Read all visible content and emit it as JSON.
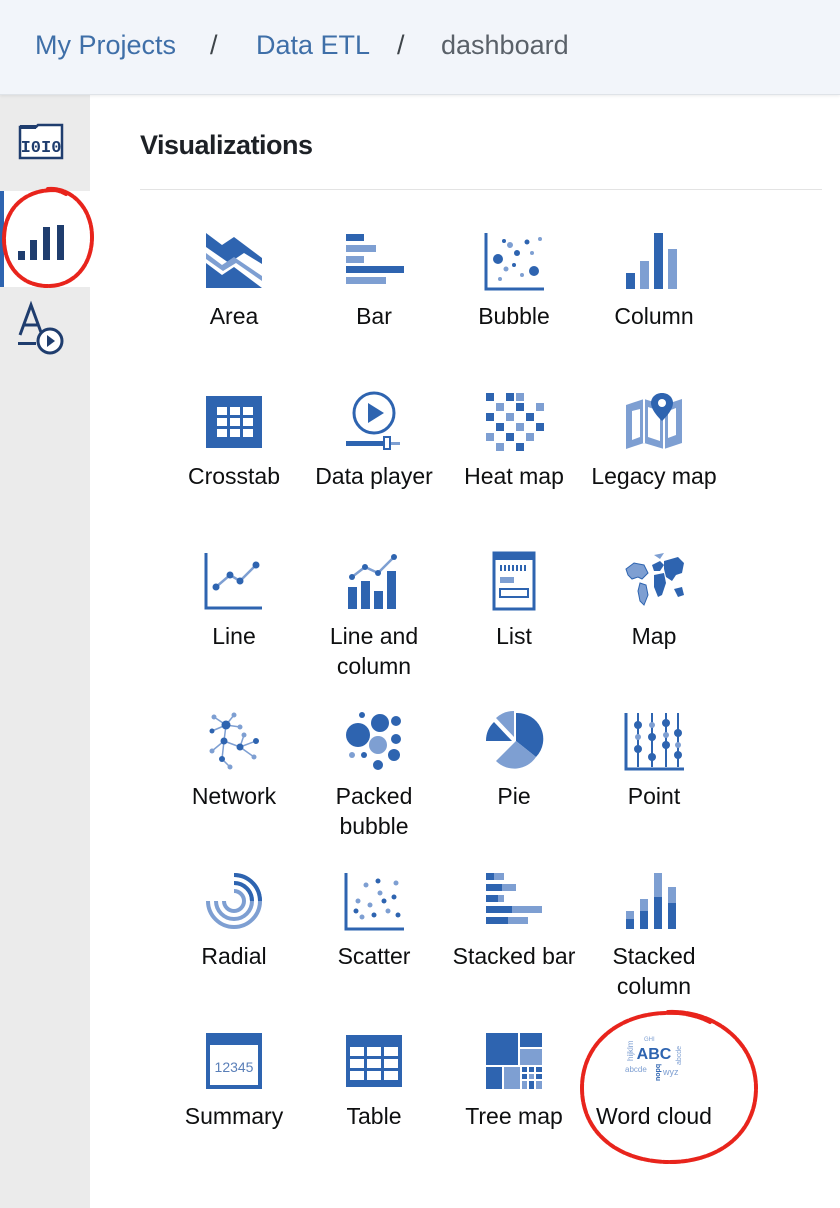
{
  "breadcrumb": {
    "items": [
      "My Projects",
      "Data ETL",
      "dashboard"
    ],
    "separator": "/"
  },
  "sidebar": {
    "items": [
      {
        "name": "data-sources",
        "icon": "binary-data-icon",
        "active": false
      },
      {
        "name": "visualizations",
        "icon": "bar-chart-icon",
        "active": true
      },
      {
        "name": "text-media",
        "icon": "text-media-icon",
        "active": false
      }
    ]
  },
  "panel": {
    "title": "Visualizations"
  },
  "visualizations": [
    {
      "label": "Area",
      "icon": "area-chart-icon"
    },
    {
      "label": "Bar",
      "icon": "bar-chart-icon"
    },
    {
      "label": "Bubble",
      "icon": "bubble-chart-icon"
    },
    {
      "label": "Column",
      "icon": "column-chart-icon"
    },
    {
      "label": "Crosstab",
      "icon": "crosstab-icon"
    },
    {
      "label": "Data player",
      "icon": "data-player-icon"
    },
    {
      "label": "Heat map",
      "icon": "heat-map-icon"
    },
    {
      "label": "Legacy map",
      "icon": "legacy-map-icon"
    },
    {
      "label": "Line",
      "icon": "line-chart-icon"
    },
    {
      "label": "Line and column",
      "icon": "line-and-column-icon"
    },
    {
      "label": "List",
      "icon": "list-icon"
    },
    {
      "label": "Map",
      "icon": "world-map-icon"
    },
    {
      "label": "Network",
      "icon": "network-icon"
    },
    {
      "label": "Packed bubble",
      "icon": "packed-bubble-icon"
    },
    {
      "label": "Pie",
      "icon": "pie-chart-icon"
    },
    {
      "label": "Point",
      "icon": "point-chart-icon"
    },
    {
      "label": "Radial",
      "icon": "radial-chart-icon"
    },
    {
      "label": "Scatter",
      "icon": "scatter-chart-icon"
    },
    {
      "label": "Stacked bar",
      "icon": "stacked-bar-icon"
    },
    {
      "label": "Stacked column",
      "icon": "stacked-column-icon"
    },
    {
      "label": "Summary",
      "icon": "summary-icon"
    },
    {
      "label": "Table",
      "icon": "table-icon"
    },
    {
      "label": "Tree map",
      "icon": "tree-map-icon"
    },
    {
      "label": "Word cloud",
      "icon": "word-cloud-icon"
    }
  ],
  "icon_text": {
    "summary": "12345",
    "word_cloud": [
      "ABC",
      "hijklm",
      "GHI",
      "abcde",
      "abcde",
      "nopq",
      "wyz"
    ]
  },
  "colors": {
    "brand": "#2e64b0",
    "light": "#7e9fd2",
    "annotation": "#e8241c",
    "breadcrumb_link": "#3f6fa8"
  }
}
